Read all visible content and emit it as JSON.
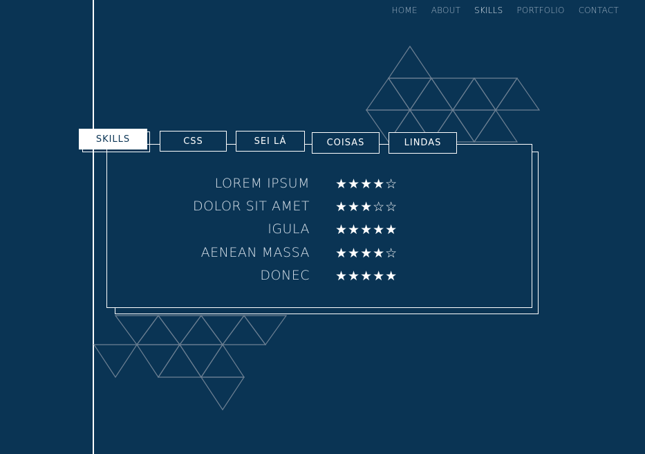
{
  "nav": {
    "items": [
      {
        "label": "HOME"
      },
      {
        "label": "ABOUT"
      },
      {
        "label": "SKILLS"
      },
      {
        "label": "PORTFOLIO"
      },
      {
        "label": "CONTACT"
      }
    ],
    "active": "SKILLS"
  },
  "tabs": [
    {
      "label": "SKILLS"
    },
    {
      "label": "CSS"
    },
    {
      "label": "SEI LÁ"
    },
    {
      "label": "COISAS"
    },
    {
      "label": "LINDAS"
    }
  ],
  "skills": [
    {
      "name": "LOREM IPSUM",
      "rating": 4,
      "stars": "★★★★☆"
    },
    {
      "name": "DOLOR SIT AMET",
      "rating": 3,
      "stars": "★★★☆☆"
    },
    {
      "name": "IGULA",
      "rating": 5,
      "stars": "★★★★★"
    },
    {
      "name": "AENEAN MASSA",
      "rating": 4,
      "stars": "★★★★☆"
    },
    {
      "name": "DONEC",
      "rating": 5,
      "stars": "★★★★★"
    }
  ],
  "colors": {
    "background": "#0a3454",
    "line": "#ffffff",
    "triangle": "#6d8093"
  }
}
